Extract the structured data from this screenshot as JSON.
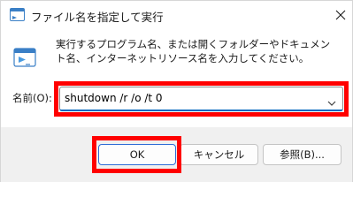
{
  "window": {
    "title": "ファイル名を指定して実行"
  },
  "content": {
    "description": "実行するプログラム名、または開くフォルダーやドキュメント名、インターネットリソース名を入力してください。",
    "open_label": "名前(O):",
    "command_value": "shutdown /r /o /t 0"
  },
  "buttons": {
    "ok": "OK",
    "cancel": "キャンセル",
    "browse": "参照(B)..."
  },
  "icons": {
    "app": "run-dialog-icon",
    "run": "run-window-icon",
    "close": "close-icon",
    "dropdown": "chevron-down-icon"
  },
  "colors": {
    "highlight": "#ff0000",
    "focus_border": "#0067c0",
    "button_band": "#f0f0f0"
  }
}
